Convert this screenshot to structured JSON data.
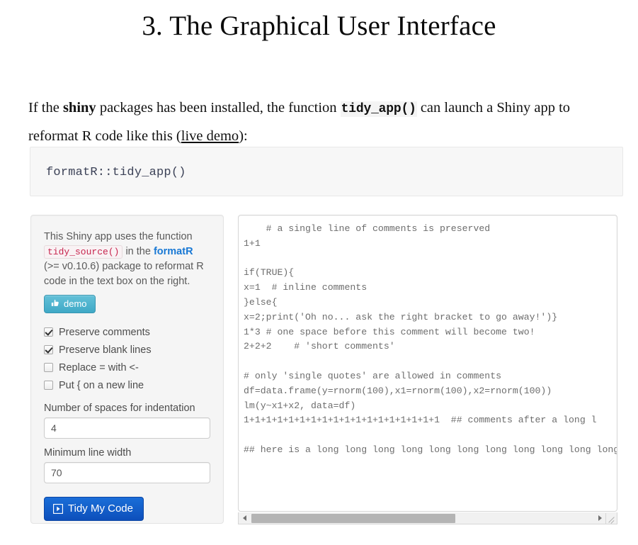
{
  "page": {
    "title": "3. The Graphical User Interface"
  },
  "intro": {
    "part1": "If the ",
    "bold_shiny": "shiny",
    "part2": " packages has been installed, the function ",
    "code_fn": "tidy_app()",
    "part3": " can launch a Shiny app to reformat R code like this (",
    "link": "live demo",
    "part4": "):"
  },
  "codeblock": {
    "code": "formatR::tidy_app()"
  },
  "sidebar": {
    "desc_part1": "This Shiny app uses the function ",
    "desc_code": "tidy_source()",
    "desc_part2": " in the ",
    "desc_pkg": "formatR",
    "desc_part3": " (>= v0.10.6) package to reformat R code in the text box on the right.",
    "demo_button": "demo",
    "checkboxes": [
      {
        "label": "Preserve comments",
        "checked": true
      },
      {
        "label": "Preserve blank lines",
        "checked": true
      },
      {
        "label": "Replace = with <-",
        "checked": false
      },
      {
        "label": "Put { on a new line",
        "checked": false
      }
    ],
    "indent_label": "Number of spaces for indentation",
    "indent_value": "4",
    "width_label": "Minimum line width",
    "width_value": "70",
    "tidy_button": "Tidy My Code"
  },
  "editor": {
    "content": "    # a single line of comments is preserved\n1+1\n\nif(TRUE){\nx=1  # inline comments\n}else{\nx=2;print('Oh no... ask the right bracket to go away!')}\n1*3 # one space before this comment will become two!\n2+2+2    # 'short comments'\n\n# only 'single quotes' are allowed in comments\ndf=data.frame(y=rnorm(100),x1=rnorm(100),x2=rnorm(100))\nlm(y~x1+x2, data=df)\n1+1+1+1+1+1+1+1+1+1+1+1+1+1+1+1+1+1  ## comments after a long l\n\n## here is a long long long long long long long long long long long long"
  },
  "colors": {
    "accent_blue": "#1a6ed8",
    "demo_teal": "#3fa9c6",
    "code_pink": "#c7254e",
    "pkg_link_blue": "#1878d4",
    "panel_bg": "#f5f5f5"
  }
}
